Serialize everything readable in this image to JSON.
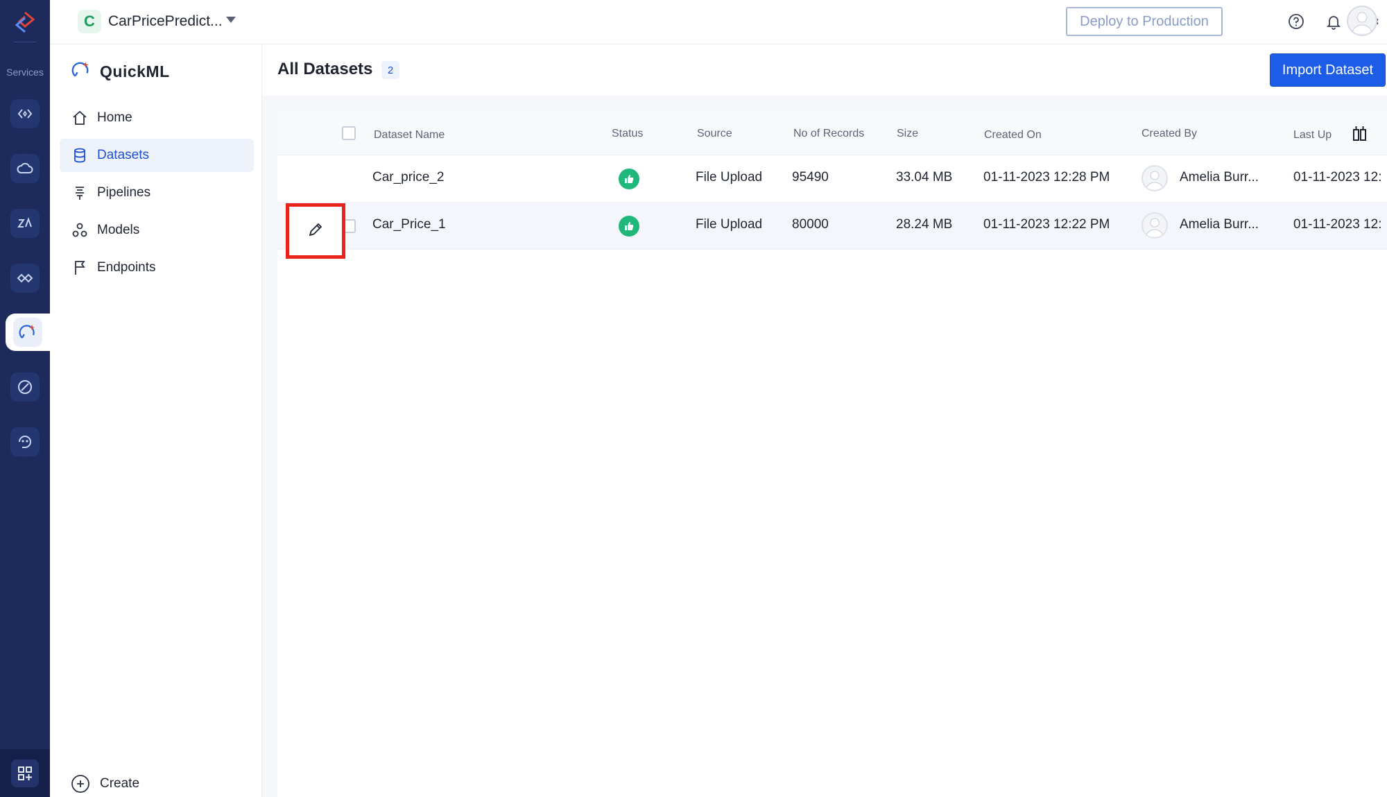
{
  "rail": {
    "services_label": "Services"
  },
  "topbar": {
    "project_initial": "C",
    "project_name": "CarPricePredict...",
    "deploy_label": "Deploy to Production"
  },
  "sidebar": {
    "brand": "QuickML",
    "items": [
      {
        "label": "Home",
        "icon": "home-icon",
        "active": false
      },
      {
        "label": "Datasets",
        "icon": "database-icon",
        "active": true
      },
      {
        "label": "Pipelines",
        "icon": "pipeline-icon",
        "active": false
      },
      {
        "label": "Models",
        "icon": "models-icon",
        "active": false
      },
      {
        "label": "Endpoints",
        "icon": "flag-icon",
        "active": false
      }
    ],
    "create_label": "Create"
  },
  "main": {
    "title": "All Datasets",
    "count": "2",
    "import_label": "Import Dataset"
  },
  "table": {
    "columns": [
      "Dataset Name",
      "Status",
      "Source",
      "No of Records",
      "Size",
      "Created On",
      "Created By",
      "Last Up"
    ],
    "rows": [
      {
        "name": "Car_price_2",
        "status": "thumbs-up",
        "source": "File Upload",
        "records": "95490",
        "size": "33.04 MB",
        "created_on": "01-11-2023 12:28 PM",
        "created_by": "Amelia Burr...",
        "last_updated": "01-11-2023 12:"
      },
      {
        "name": "Car_Price_1",
        "status": "thumbs-up",
        "source": "File Upload",
        "records": "80000",
        "size": "28.24 MB",
        "created_on": "01-11-2023 12:22 PM",
        "created_by": "Amelia Burr...",
        "last_updated": "01-11-2023 12:"
      }
    ]
  },
  "colors": {
    "rail_bg": "#1c2a5c",
    "accent": "#1d5ce6",
    "status_green": "#1fb87a",
    "highlight_red": "#e8231a"
  }
}
